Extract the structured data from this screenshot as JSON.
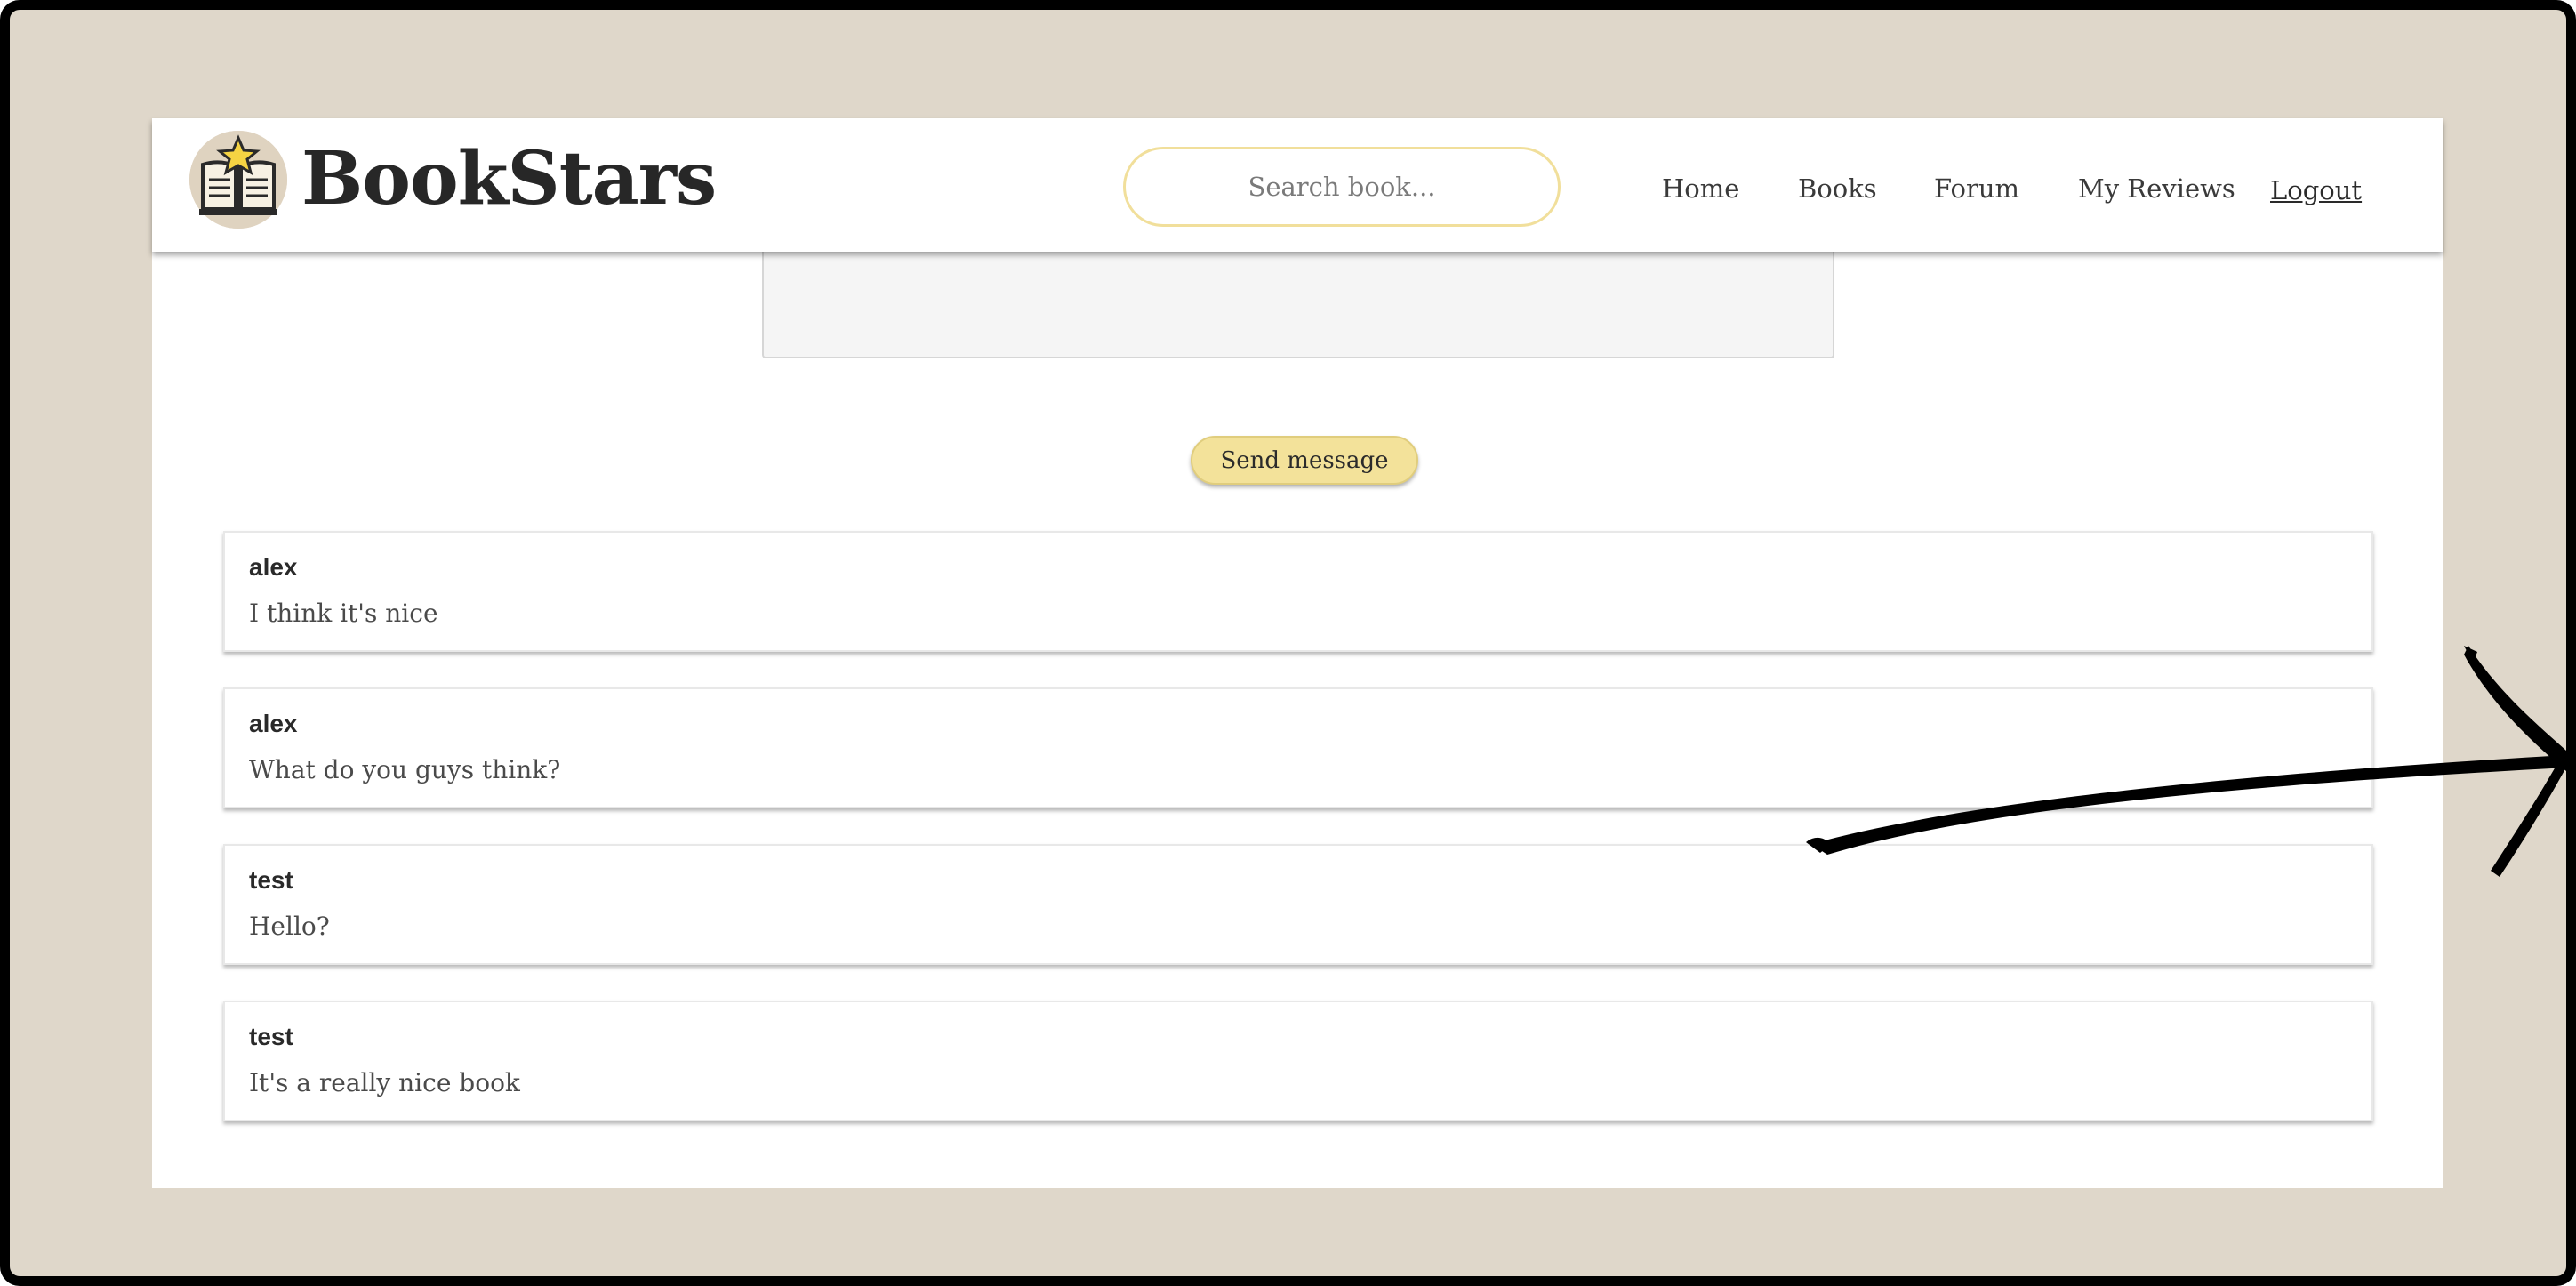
{
  "brand": {
    "name": "BookStars",
    "logo_icon": "book-star-icon"
  },
  "search": {
    "placeholder": "Search book..."
  },
  "nav": {
    "home": "Home",
    "books": "Books",
    "forum": "Forum",
    "my_reviews": "My Reviews",
    "logout": "Logout"
  },
  "composer": {
    "message_text": "",
    "send_label": "Send message"
  },
  "messages": [
    {
      "author": "alex",
      "text": "I think it's nice"
    },
    {
      "author": "alex",
      "text": "What do you guys think?"
    },
    {
      "author": "test",
      "text": "Hello?"
    },
    {
      "author": "test",
      "text": "It's a really nice book"
    }
  ],
  "annotation": {
    "icon": "hand-drawn-arrow-icon",
    "color": "#000000"
  },
  "colors": {
    "frame_background": "#dfd7ca",
    "accent_yellow": "#f3e29a",
    "search_border": "#f1df9b",
    "logo_badge": "#dfd3c0"
  }
}
